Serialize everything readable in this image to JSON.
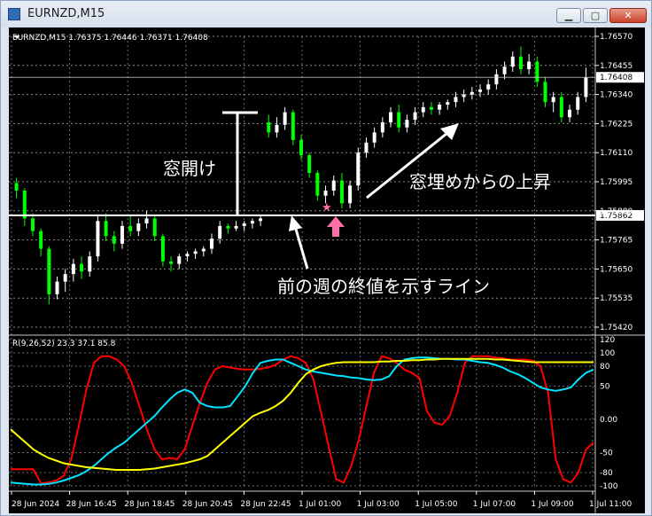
{
  "window": {
    "title": "EURNZD,M15"
  },
  "controls": {
    "minimize": "▁",
    "maximize": "▢",
    "close": "✕"
  },
  "chart_data": [
    {
      "type": "candlestick",
      "header": "EURNZD,M15  1.76375 1.76446 1.76371 1.76408",
      "symbol": "EURNZD",
      "timeframe": "M15",
      "ohlc": {
        "open": 1.76375,
        "high": 1.76446,
        "low": 1.76371,
        "close": 1.76408
      },
      "ylim": [
        1.7542,
        1.7657
      ],
      "price_ticks": [
        1.7657,
        1.76455,
        1.7634,
        1.76225,
        1.7611,
        1.75995,
        1.7588,
        1.75765,
        1.7565,
        1.75535,
        1.7542
      ],
      "current_price": 1.76408,
      "current_price_label": "1.76408",
      "gap_line_price": 1.75862,
      "gap_line_label": "1.75862",
      "x_ticks": [
        "28 Jun 2024",
        "28 Jun 16:45",
        "28 Jun 18:45",
        "28 Jun 20:45",
        "28 Jun 22:45",
        "1 Jul 01:00",
        "1 Jul 03:00",
        "1 Jul 05:00",
        "1 Jul 07:00",
        "1 Jul 09:00",
        "1 Jul 11:00"
      ],
      "candles": [
        [
          1.7599,
          1.7601,
          1.7593,
          1.7596
        ],
        [
          1.7596,
          1.7597,
          1.7582,
          1.7585
        ],
        [
          1.7585,
          1.7587,
          1.7578,
          1.758
        ],
        [
          1.758,
          1.7581,
          1.757,
          1.7573
        ],
        [
          1.7573,
          1.7574,
          1.7551,
          1.7555
        ],
        [
          1.7555,
          1.7562,
          1.7553,
          1.756
        ],
        [
          1.756,
          1.7565,
          1.7556,
          1.7563
        ],
        [
          1.7563,
          1.7569,
          1.756,
          1.7567
        ],
        [
          1.7567,
          1.757,
          1.7561,
          1.7564
        ],
        [
          1.7564,
          1.7572,
          1.7562,
          1.757
        ],
        [
          1.757,
          1.7586,
          1.7568,
          1.7584
        ],
        [
          1.7584,
          1.7587,
          1.7576,
          1.7578
        ],
        [
          1.7578,
          1.758,
          1.7572,
          1.7575
        ],
        [
          1.7575,
          1.7584,
          1.7573,
          1.7582
        ],
        [
          1.7582,
          1.7586,
          1.7578,
          1.758
        ],
        [
          1.758,
          1.7585,
          1.7578,
          1.7583
        ],
        [
          1.7583,
          1.7588,
          1.7581,
          1.7585
        ],
        [
          1.7585,
          1.7586,
          1.7576,
          1.7578
        ],
        [
          1.7578,
          1.7579,
          1.7566,
          1.7568
        ],
        [
          1.7568,
          1.757,
          1.7564,
          1.7567
        ],
        [
          1.7567,
          1.7571,
          1.7565,
          1.757
        ],
        [
          1.757,
          1.7572,
          1.7568,
          1.7571
        ],
        [
          1.7571,
          1.7573,
          1.7569,
          1.7572
        ],
        [
          1.7572,
          1.7574,
          1.757,
          1.7573
        ],
        [
          1.7573,
          1.7579,
          1.7571,
          1.7577
        ],
        [
          1.7577,
          1.7584,
          1.7575,
          1.7582
        ],
        [
          1.7582,
          1.7583,
          1.7579,
          1.7581
        ],
        [
          1.7581,
          1.7584,
          1.758,
          1.7582
        ],
        [
          1.7582,
          1.7584,
          1.758,
          1.7583
        ],
        [
          1.7583,
          1.7585,
          1.7581,
          1.7584
        ],
        [
          1.7584,
          1.7586,
          1.7582,
          1.7585
        ],
        [
          1.7623,
          1.7626,
          1.7617,
          1.7619
        ],
        [
          1.7619,
          1.7625,
          1.7617,
          1.7622
        ],
        [
          1.7622,
          1.7629,
          1.762,
          1.7627
        ],
        [
          1.7627,
          1.7628,
          1.7614,
          1.7616
        ],
        [
          1.7616,
          1.7618,
          1.7608,
          1.761
        ],
        [
          1.761,
          1.7611,
          1.7601,
          1.7603
        ],
        [
          1.7603,
          1.7604,
          1.7592,
          1.7594
        ],
        [
          1.7594,
          1.7598,
          1.7591,
          1.7596
        ],
        [
          1.7596,
          1.7602,
          1.7594,
          1.76
        ],
        [
          1.76,
          1.7603,
          1.7589,
          1.7591
        ],
        [
          1.7591,
          1.76,
          1.7589,
          1.7598
        ],
        [
          1.7598,
          1.7613,
          1.7596,
          1.7611
        ],
        [
          1.7611,
          1.7617,
          1.7609,
          1.7615
        ],
        [
          1.7615,
          1.7621,
          1.7613,
          1.7619
        ],
        [
          1.7619,
          1.7625,
          1.7617,
          1.7623
        ],
        [
          1.7623,
          1.7629,
          1.7621,
          1.7627
        ],
        [
          1.7627,
          1.763,
          1.7619,
          1.7621
        ],
        [
          1.7621,
          1.7626,
          1.7619,
          1.7624
        ],
        [
          1.7624,
          1.7629,
          1.7622,
          1.7627
        ],
        [
          1.7627,
          1.7631,
          1.7625,
          1.7629
        ],
        [
          1.7629,
          1.7631,
          1.7626,
          1.7628
        ],
        [
          1.7628,
          1.7631,
          1.7626,
          1.763
        ],
        [
          1.763,
          1.7632,
          1.7628,
          1.7631
        ],
        [
          1.7631,
          1.7635,
          1.7629,
          1.7633
        ],
        [
          1.7633,
          1.7636,
          1.7631,
          1.7634
        ],
        [
          1.7634,
          1.7637,
          1.7632,
          1.7635
        ],
        [
          1.7635,
          1.7638,
          1.7633,
          1.7636
        ],
        [
          1.7636,
          1.764,
          1.7634,
          1.7638
        ],
        [
          1.7638,
          1.7644,
          1.7636,
          1.7642
        ],
        [
          1.7642,
          1.7647,
          1.764,
          1.7645
        ],
        [
          1.7645,
          1.7651,
          1.7643,
          1.7649
        ],
        [
          1.7649,
          1.7653,
          1.7642,
          1.7644
        ],
        [
          1.7644,
          1.765,
          1.7642,
          1.7647
        ],
        [
          1.7647,
          1.7649,
          1.7637,
          1.7639
        ],
        [
          1.7639,
          1.7641,
          1.7629,
          1.7631
        ],
        [
          1.7631,
          1.7635,
          1.7627,
          1.7633
        ],
        [
          1.7633,
          1.7635,
          1.7623,
          1.7625
        ],
        [
          1.7625,
          1.763,
          1.7623,
          1.7628
        ],
        [
          1.7628,
          1.7635,
          1.7626,
          1.7633
        ],
        [
          1.7633,
          1.76446,
          1.7631,
          1.76408
        ]
      ],
      "gap_index": 31,
      "annotations": {
        "gap_open": "窓開け",
        "gap_fill_rise": "窓埋めからの上昇",
        "prev_week_close_line": "前の週の終値を示すライン",
        "star_mark": "★"
      },
      "colors": {
        "bull": "#ffffff",
        "bear": "#00ff00",
        "grid": "#c8c8c8",
        "star": "#ff6fa8",
        "arrow": "#ff6fa8"
      }
    },
    {
      "type": "line",
      "header": "R(9,26,52) 23.3 37.1 85.8",
      "ylim": [
        -100,
        120
      ],
      "y_ticks": [
        120,
        100,
        80,
        50,
        0,
        -50,
        -80,
        -100
      ],
      "y_tick_labels": [
        "120",
        "100",
        "80",
        "50",
        "0.00",
        "-50",
        "-80",
        "-100"
      ],
      "series": [
        {
          "color": "#ff0000",
          "values": [
            -75,
            -75,
            -75,
            -75,
            -96,
            -95,
            -92,
            -85,
            -60,
            -10,
            45,
            85,
            95,
            95,
            90,
            80,
            55,
            20,
            -15,
            -45,
            -60,
            -58,
            -60,
            -45,
            -10,
            25,
            55,
            75,
            80,
            78,
            76,
            75,
            75,
            76,
            78,
            82,
            90,
            95,
            92,
            85,
            60,
            10,
            -40,
            -90,
            -95,
            -70,
            -30,
            20,
            70,
            95,
            92,
            85,
            75,
            70,
            62,
            12,
            -5,
            -8,
            5,
            40,
            85,
            95,
            95,
            95,
            93,
            92,
            90,
            90,
            90,
            88,
            80,
            40,
            -60,
            -90,
            -95,
            -80,
            -45,
            -35
          ]
        },
        {
          "color": "#00e5ff",
          "values": [
            -95,
            -96,
            -97,
            -98,
            -98,
            -97,
            -95,
            -92,
            -88,
            -84,
            -78,
            -70,
            -60,
            -50,
            -42,
            -35,
            -25,
            -15,
            -5,
            5,
            18,
            30,
            40,
            45,
            40,
            25,
            20,
            18,
            18,
            20,
            35,
            50,
            70,
            85,
            88,
            90,
            90,
            85,
            80,
            75,
            72,
            70,
            68,
            66,
            65,
            63,
            62,
            60,
            59,
            60,
            65,
            80,
            90,
            92,
            93,
            93,
            92,
            91,
            91,
            90,
            90,
            88,
            86,
            85,
            82,
            78,
            72,
            68,
            62,
            55,
            48,
            45,
            43,
            45,
            48,
            60,
            70,
            75
          ]
        },
        {
          "color": "#ffff00",
          "values": [
            -15,
            -25,
            -35,
            -45,
            -52,
            -58,
            -62,
            -66,
            -68,
            -70,
            -72,
            -73,
            -74,
            -75,
            -76,
            -76,
            -76,
            -76,
            -75,
            -74,
            -72,
            -70,
            -68,
            -66,
            -63,
            -60,
            -55,
            -45,
            -35,
            -25,
            -15,
            -5,
            5,
            10,
            14,
            20,
            28,
            40,
            55,
            68,
            75,
            80,
            83,
            85,
            86,
            86,
            86,
            86,
            86,
            87,
            87,
            88,
            88,
            89,
            89,
            90,
            90,
            91,
            91,
            91,
            91,
            91,
            91,
            91,
            90,
            90,
            89,
            88,
            87,
            86,
            86,
            86,
            86,
            86,
            86,
            86,
            86,
            86
          ]
        }
      ],
      "colors": {
        "grid": "#c8c8c8"
      }
    }
  ]
}
